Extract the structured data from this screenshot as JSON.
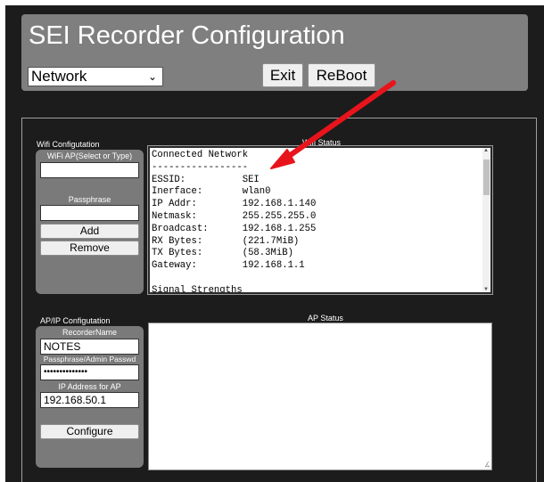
{
  "header": {
    "title": "SEI Recorder Configuration",
    "mode_select": "Network",
    "exit_label": "Exit",
    "reboot_label": "ReBoot"
  },
  "wifi": {
    "section_label": "Wifi Configutation",
    "ap_label": "WiFi AP(Select or Type)",
    "ap_value": "",
    "passphrase_label": "Passphrase",
    "passphrase_value": "",
    "add_label": "Add",
    "remove_label": "Remove"
  },
  "wifi_status": {
    "label": "Wifi Status",
    "text": "Connected Network\n-----------------\nESSID:          SEI\nInerface:       wlan0\nIP Addr:        192.168.1.140\nNetmask:        255.255.255.0\nBroadcast:      192.168.1.255\nRX Bytes:       (221.7MiB)\nTX Bytes:       (58.3MiB)\nGateway:        192.168.1.1\n\nSignal Strengths"
  },
  "ap_config": {
    "section_label": "AP/IP Configutation",
    "recorder_name_label": "RecorderName",
    "recorder_name_value": "NOTES",
    "password_label": "Passphrase/Admin Passwd",
    "password_value": "••••••••••••••",
    "ip_label": "IP Address for AP",
    "ip_value": "192.168.50.1",
    "configure_label": "Configure"
  },
  "ap_status": {
    "label": "AP Status",
    "text": ""
  },
  "annotation": {
    "arrow_color": "#e8141c",
    "icon": "red-arrow"
  },
  "icons": {
    "chevron": "chevron-down-icon",
    "resize": "resize-grip-icon"
  }
}
